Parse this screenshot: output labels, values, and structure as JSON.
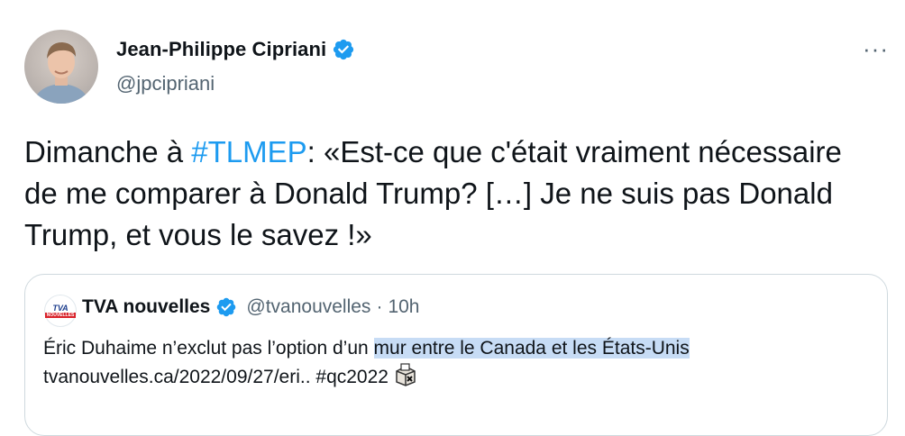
{
  "tweet": {
    "author_name": "Jean-Philippe Cipriani",
    "author_handle": "@jpcipriani",
    "more_label": "···",
    "text_before": "Dimanche à ",
    "hashtag": "#TLMEP",
    "text_after": ": «Est-ce que c'était vraiment nécessaire de me comparer à Donald Trump? […] Je ne suis pas Donald Trump, et vous le savez !»"
  },
  "quote": {
    "logo_text": "TVA",
    "logo_subtext": "NOUVELLES",
    "author_name": "TVA nouvelles",
    "author_handle": "@tvanouvelles",
    "separator": "·",
    "time": "10h",
    "text_plain": "Éric Duhaime n’exclut pas l’option d’un",
    "text_highlighted": "mur entre le Canada et les États-Unis",
    "link": "tvanouvelles.ca/2022/09/27/eri..",
    "hashtag": "#qc2022"
  },
  "colors": {
    "accent": "#1d9bf0",
    "secondary_text": "#536471",
    "highlight": "#c7dcf5"
  },
  "icons": [
    "verified-badge-icon",
    "more-options-icon",
    "ballot-box-icon"
  ]
}
